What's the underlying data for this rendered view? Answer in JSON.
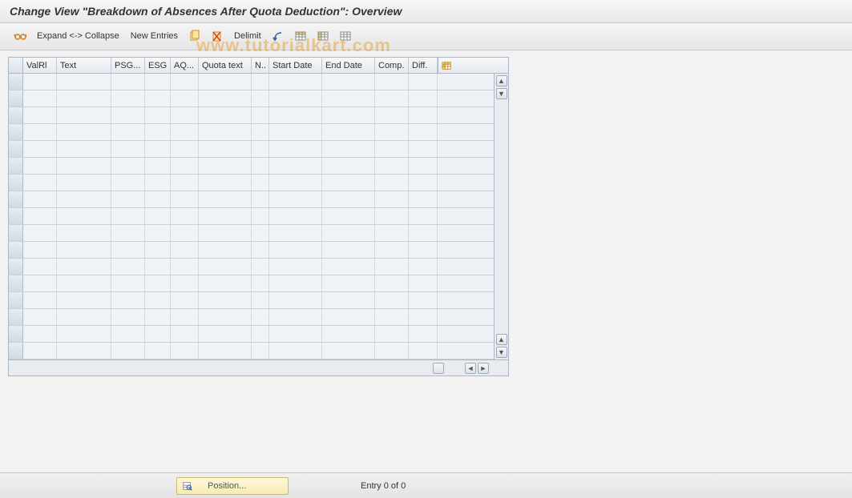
{
  "title": "Change View \"Breakdown of Absences After Quota Deduction\": Overview",
  "toolbar": {
    "expand_collapse": "Expand <-> Collapse",
    "new_entries": "New Entries",
    "delimit": "Delimit"
  },
  "watermark": "www.tutorialkart.com",
  "columns": {
    "valrl": "ValRl",
    "text": "Text",
    "psg": "PSG...",
    "esg": "ESG",
    "aq": "AQ...",
    "quota": "Quota text",
    "n": "N..",
    "start": "Start Date",
    "end": "End Date",
    "comp": "Comp.",
    "diff": "Diff."
  },
  "rows_count": 17,
  "status": {
    "position_label": "Position...",
    "entry_text": "Entry 0 of 0"
  }
}
